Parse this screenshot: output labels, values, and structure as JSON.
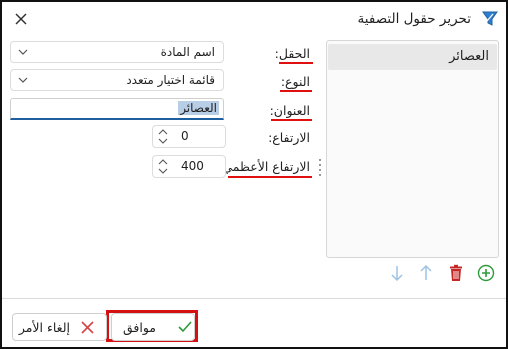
{
  "dialog": {
    "title": "تحرير حقول التصفية",
    "title_icon": "filter-icon",
    "close_icon": "close-icon"
  },
  "list": {
    "items": [
      "العصائر"
    ],
    "buttons": {
      "add": "add-icon",
      "delete": "trash-icon",
      "move_up": "arrow-up-icon",
      "move_down": "arrow-down-icon"
    }
  },
  "form": {
    "field_label": "الحقل:",
    "field_value": "اسم المادة",
    "type_label": "النوع:",
    "type_value": "قائمة اختيار متعدد",
    "title_label": "العنوان:",
    "title_value": "العصائر",
    "height_label": "الارتفاع:",
    "height_value": "0",
    "max_height_label": "الارتفاع الأعظمي:",
    "max_height_value": "400"
  },
  "footer": {
    "ok_label": "موافق",
    "cancel_label": "إلغاء الأمر"
  },
  "colors": {
    "accent": "#1f5f9f",
    "highlight": "#d41010",
    "ok_check": "#2e9b3a",
    "cancel_x": "#d64545",
    "add_green": "#2e9b3a",
    "delete_red": "#c62828",
    "arrow_disabled": "#9ec3e6"
  }
}
